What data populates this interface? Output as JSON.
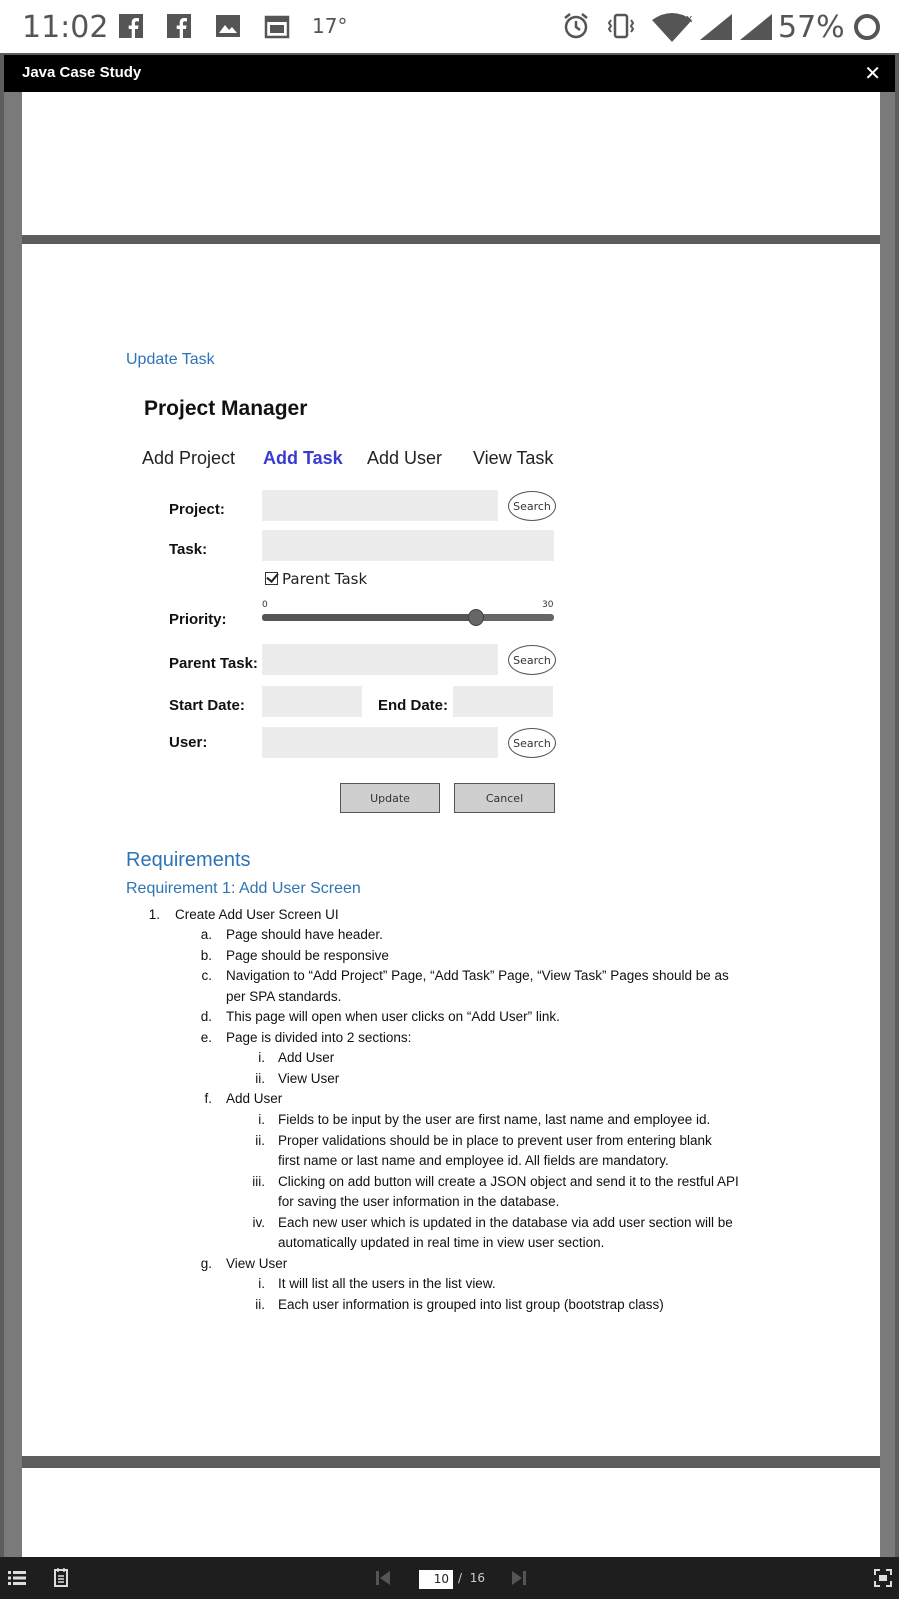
{
  "status_bar": {
    "time": "11:02",
    "temperature": "17°",
    "battery": "57%",
    "icons": [
      "facebook-icon",
      "facebook-icon",
      "image-icon",
      "calendar-icon",
      "alarm-icon",
      "vibrate-icon",
      "wifi-icon",
      "signal-icon",
      "signal-icon",
      "battery-icon"
    ]
  },
  "viewer": {
    "title": "Java Case Study",
    "close_glyph": "✕"
  },
  "document": {
    "update_heading": "Update Task",
    "mockup": {
      "title": "Project Manager",
      "nav": [
        "Add Project",
        "Add Task",
        "Add User",
        "View Task"
      ],
      "active_nav": "Add Task",
      "labels": {
        "project": "Project:",
        "task": "Task:",
        "priority": "Priority:",
        "parent_task": "Parent Task:",
        "start_date": "Start Date:",
        "end_date": "End Date:",
        "user": "User:"
      },
      "parent_task_checkbox": "Parent Task",
      "search_label": "Search",
      "priority_min": "0",
      "priority_max": "30",
      "priority_value": 22,
      "update_label": "Update",
      "cancel_label": "Cancel"
    },
    "requirements_heading": "Requirements",
    "requirement1_heading": "Requirement 1: Add User Screen",
    "items": [
      {
        "num": "1.",
        "text": "Create Add User Screen UI"
      },
      {
        "num": "a.",
        "text": "Page should have header."
      },
      {
        "num": "b.",
        "text": "Page should be responsive"
      },
      {
        "num": "c.",
        "text": "Navigation to “Add Project” Page, “Add Task” Page, “View Task” Pages should be as"
      },
      {
        "num": "",
        "text": "per SPA standards."
      },
      {
        "num": "d.",
        "text": "This page will open when user clicks on “Add User” link."
      },
      {
        "num": "e.",
        "text": "Page is divided into 2 sections:"
      },
      {
        "num": "i.",
        "text": "Add User"
      },
      {
        "num": "ii.",
        "text": "View User"
      },
      {
        "num": "f.",
        "text": "Add User"
      },
      {
        "num": "i.",
        "text": "Fields to be input by the user are first name, last name and employee id."
      },
      {
        "num": "ii.",
        "text": "Proper validations should be in place to prevent user from entering blank"
      },
      {
        "num": "",
        "text": "first name or last name and employee id. All fields are mandatory."
      },
      {
        "num": "iii.",
        "text": "Clicking on add button will create a JSON object and send it to the restful API"
      },
      {
        "num": "",
        "text": "for saving the user information in the database."
      },
      {
        "num": "iv.",
        "text": "Each new user which is updated in the database via add user section will be"
      },
      {
        "num": "",
        "text": "automatically updated in real time in view user section."
      },
      {
        "num": "g.",
        "text": "View User"
      },
      {
        "num": "i.",
        "text": "It will list all the users in the list view."
      },
      {
        "num": "ii.",
        "text": "Each user information is grouped into list group (bootstrap class)"
      }
    ]
  },
  "pager": {
    "current_page": "10",
    "separator": "/",
    "total_pages": "16"
  },
  "colors": {
    "heading_blue": "#2e74b5",
    "active_nav": "#3a3ad0",
    "viewer_bg": "#5d5d5d"
  }
}
